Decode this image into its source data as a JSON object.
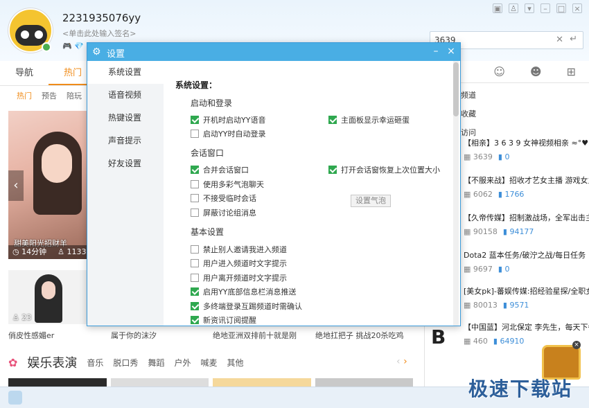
{
  "profile": {
    "username": "2231935076yy",
    "signature": "<单击此处输入签名>",
    "status_text": "1"
  },
  "search": {
    "value": "3639"
  },
  "nav": {
    "tabs": [
      "导航",
      "热门"
    ],
    "sub_tabs": [
      "热门",
      "预告",
      "陪玩"
    ]
  },
  "cards": {
    "featured_title": "甜美阳光招财羊",
    "featured_time": "14分钟",
    "featured_viewers": "1133",
    "small_viewers": "23"
  },
  "captions": [
    "俏皮性感媚er",
    "属于你的沫汐",
    "绝地亚洲双排前十就是刚",
    "绝地扛把子 挑战20杀吃鸡"
  ],
  "section": {
    "title": "娱乐表演",
    "links": [
      "音乐",
      "脱口秀",
      "舞蹈",
      "户外",
      "喊麦",
      "其他"
    ]
  },
  "right_panel": {
    "links": [
      "频道",
      "收藏",
      "访问"
    ],
    "channels": [
      {
        "title": "【相亲】3 6 3 9 女神视频相亲 ≈°♥♥",
        "id": "3639",
        "online": "0"
      },
      {
        "title": "【不服来战】招收才艺女主播 游戏女主播",
        "id": "6062",
        "online": "1766"
      },
      {
        "title": "【久帝传媒】招制激战场，全军出击主播",
        "id": "90158",
        "online": "94177"
      },
      {
        "title": "Dota2 蓝本任务/破泞之战/每日任务",
        "id": "9697",
        "online": "0"
      },
      {
        "title": "[美女pk]-蕃娱传媒:招经验星探/全职女主播",
        "id": "80013",
        "online": "9571"
      },
      {
        "title": "【中国蓝】河北保定 李先生，每天下午3点",
        "id": "460",
        "online": "64910"
      }
    ]
  },
  "watermark": "极速下载站",
  "dialog": {
    "title": "设置",
    "nav": [
      "系统设置",
      "语音视频",
      "热键设置",
      "声音提示",
      "好友设置"
    ],
    "heading": "系统设置：",
    "groups": {
      "startup": "启动和登录",
      "session": "会话窗口",
      "basic": "基本设置"
    },
    "startup_options": [
      {
        "label": "开机时启动YY语音",
        "checked": true
      },
      {
        "label": "主面板显示幸运砸蛋",
        "checked": true
      },
      {
        "label": "启动YY时自动登录",
        "checked": false
      }
    ],
    "session_options": [
      {
        "label": "合并会话窗口",
        "checked": true
      },
      {
        "label": "打开会话窗恢复上次位置大小",
        "checked": true
      },
      {
        "label": "使用多彩气泡聊天",
        "checked": false
      },
      {
        "label": "不接受临时会话",
        "checked": false
      },
      {
        "label": "屏蔽讨论组消息",
        "checked": false
      }
    ],
    "bubble_button": "设置气泡",
    "basic_options": [
      {
        "label": "禁止别人邀请我进入频道",
        "checked": false
      },
      {
        "label": "用户进入频道时文字提示",
        "checked": false
      },
      {
        "label": "用户离开频道时文字提示",
        "checked": false
      },
      {
        "label": "启用YY底部信息栏消息推送",
        "checked": true
      },
      {
        "label": "多终端登录互踢频道时需确认",
        "checked": true
      },
      {
        "label": "新资讯订阅提醒",
        "checked": true
      }
    ]
  },
  "colors": {
    "accent_orange": "#f08c1a",
    "dialog_blue": "#49aee4",
    "check_green": "#2fa84f",
    "link_blue": "#3d8ed8"
  }
}
